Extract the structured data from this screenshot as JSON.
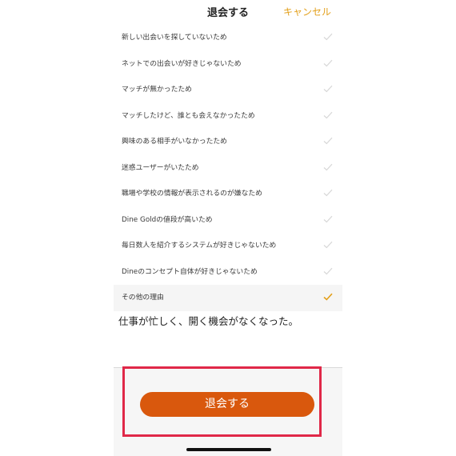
{
  "header": {
    "title": "退会する",
    "cancel_label": "キャンセル"
  },
  "reasons": [
    {
      "label": "新しい出会いを探していないため",
      "checked": false
    },
    {
      "label": "ネットでの出会いが好きじゃないため",
      "checked": false
    },
    {
      "label": "マッチが無かったため",
      "checked": false
    },
    {
      "label": "マッチしたけど、誰とも会えなかったため",
      "checked": false
    },
    {
      "label": "興味のある相手がいなかったため",
      "checked": false
    },
    {
      "label": "迷惑ユーザーがいたため",
      "checked": false
    },
    {
      "label": "職場や学校の情報が表示されるのが嫌なため",
      "checked": false
    },
    {
      "label": "Dine Goldの値段が高いため",
      "checked": false
    },
    {
      "label": "毎日数人を紹介するシステムが好きじゃないため",
      "checked": false
    },
    {
      "label": "Dineのコンセプト自体が好きじゃないため",
      "checked": false
    },
    {
      "label": "その他の理由",
      "checked": true
    }
  ],
  "other_reason": {
    "value": "仕事が忙しく、開く機会がなくなった。"
  },
  "footer": {
    "withdraw_label": "退会する"
  },
  "colors": {
    "accent": "#e3a01c",
    "button": "#d9580d",
    "highlight": "#e02848",
    "check_unselected": "#d8d8d8",
    "check_selected": "#e3a01c"
  }
}
